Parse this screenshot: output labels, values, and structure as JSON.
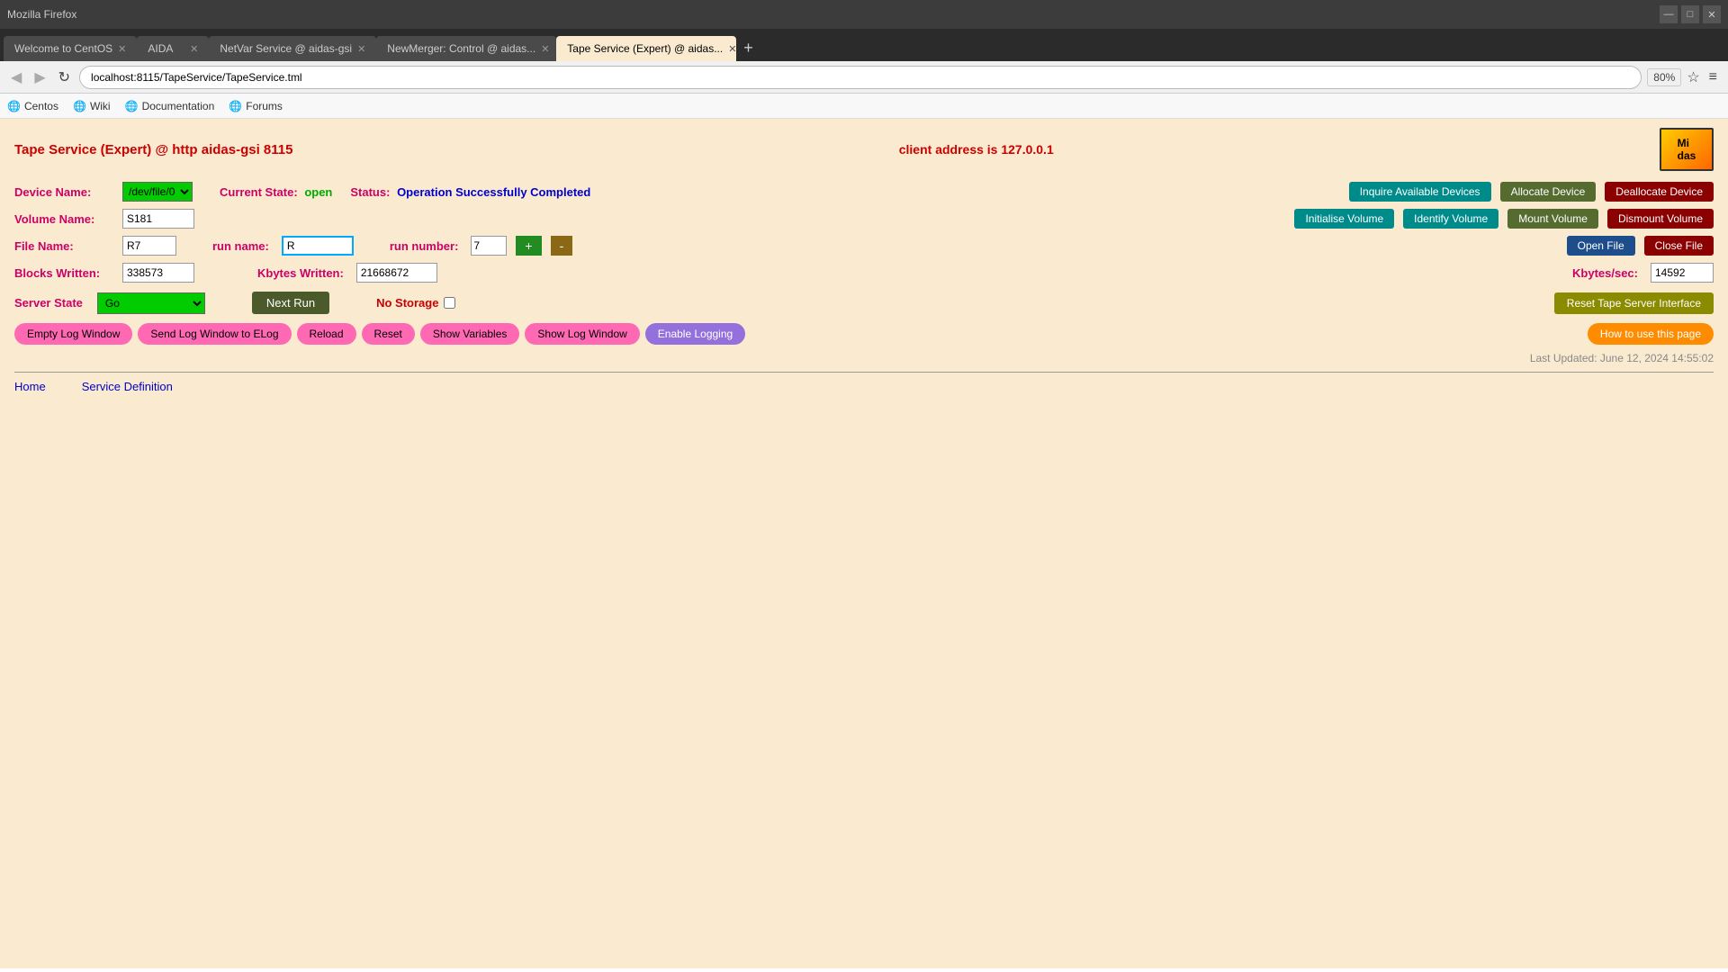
{
  "browser": {
    "tabs": [
      {
        "id": "welcome",
        "label": "Welcome to CentOS",
        "active": false,
        "closable": true
      },
      {
        "id": "aida",
        "label": "AIDA",
        "active": false,
        "closable": true
      },
      {
        "id": "netvar",
        "label": "NetVar Service @ aidas-gsi",
        "active": false,
        "closable": true
      },
      {
        "id": "newmerger",
        "label": "NewMerger: Control @ aidas...",
        "active": false,
        "closable": true
      },
      {
        "id": "tapeservice",
        "label": "Tape Service (Expert) @ aidas...",
        "active": true,
        "closable": true
      }
    ],
    "url": "localhost:8115/TapeService/TapeService.tml",
    "zoom": "80%"
  },
  "bookmarks": [
    {
      "id": "centos",
      "label": "Centos",
      "icon": "🌐"
    },
    {
      "id": "wiki",
      "label": "Wiki",
      "icon": "🌐"
    },
    {
      "id": "documentation",
      "label": "Documentation",
      "icon": "🌐"
    },
    {
      "id": "forums",
      "label": "Forums",
      "icon": "🌐"
    }
  ],
  "page": {
    "title": "Tape Service (Expert) @ http aidas-gsi 8115",
    "client_address_label": "client address is 127.0.0.1",
    "logo_text": "Midas"
  },
  "form": {
    "device_name_label": "Device Name:",
    "device_name_value": "/dev/file/0",
    "volume_name_label": "Volume Name:",
    "volume_name_value": "S181",
    "file_name_label": "File Name:",
    "file_name_value": "R7",
    "run_name_label": "run name:",
    "run_name_value": "R",
    "run_number_label": "run number:",
    "run_number_value": "7",
    "blocks_written_label": "Blocks Written:",
    "blocks_written_value": "338573",
    "kbytes_written_label": "Kbytes Written:",
    "kbytes_written_value": "21668672",
    "kbytes_sec_label": "Kbytes/sec:",
    "kbytes_sec_value": "14592",
    "current_state_label": "Current State:",
    "current_state_value": "open",
    "status_label": "Status:",
    "status_value": "Operation Successfully Completed",
    "server_state_label": "Server State",
    "server_state_value": "Go",
    "no_storage_label": "No Storage",
    "plus_label": "+",
    "minus_label": "-"
  },
  "buttons": {
    "inquire_available_devices": "Inquire Available Devices",
    "allocate_device": "Allocate Device",
    "deallocate_device": "Deallocate Device",
    "initialise_volume": "Initialise Volume",
    "identify_volume": "Identify Volume",
    "mount_volume": "Mount Volume",
    "dismount_volume": "Dismount Volume",
    "open_file": "Open File",
    "close_file": "Close File",
    "next_run": "Next Run",
    "reset_tape_server_interface": "Reset Tape Server Interface",
    "empty_log_window": "Empty Log Window",
    "send_log_window_to_elog": "Send Log Window to ELog",
    "reload": "Reload",
    "reset": "Reset",
    "show_variables": "Show Variables",
    "show_log_window": "Show Log Window",
    "enable_logging": "Enable Logging",
    "how_to_use": "How to use this page"
  },
  "footer": {
    "last_updated": "Last Updated: June 12, 2024 14:55:02",
    "home_label": "Home",
    "service_definition_label": "Service Definition"
  }
}
